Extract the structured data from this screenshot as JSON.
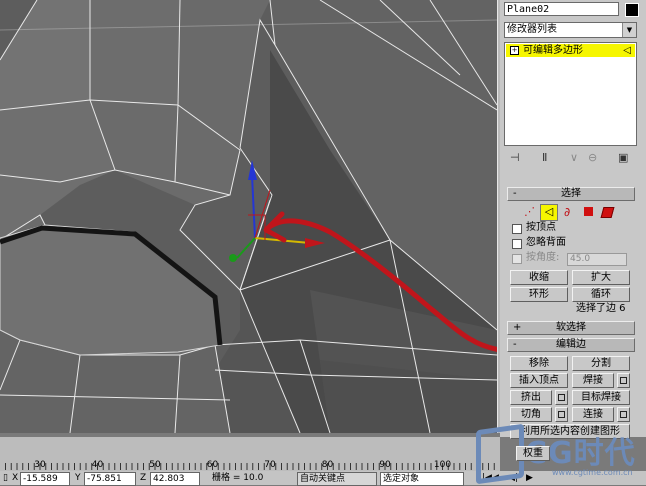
{
  "panel": {
    "object_name": "Plane02",
    "object_color": "#000000",
    "modifier_list": "修改器列表",
    "stack_item": "可编辑多边形",
    "stack_highlight": "#f6f600"
  },
  "rollouts": {
    "selection": {
      "header": "选择",
      "sign": "-",
      "by_vertex": "按顶点",
      "ignore_backfacing": "忽略背面",
      "by_angle": "按角度:",
      "angle_value": "45.0",
      "shrink": "收缩",
      "grow": "扩大",
      "ring": "环形",
      "loop": "循环",
      "status": "选择了边 6"
    },
    "soft_selection": {
      "header": "软选择",
      "sign": "+"
    },
    "edit_edges": {
      "header": "编辑边",
      "sign": "-",
      "remove": "移除",
      "split": "分割",
      "insert_vertex": "插入顶点",
      "weld": "焊接",
      "extrude": "挤出",
      "target_weld": "目标焊接",
      "chamfer": "切角",
      "connect": "连接",
      "create_shape": "利用所选内容创建图形",
      "weight": "权重"
    }
  },
  "timeline": {
    "ticks": [
      "30",
      "40",
      "50",
      "60",
      "70",
      "80",
      "90",
      "100"
    ]
  },
  "status": {
    "x_label": "X",
    "x_value": "-15.589",
    "y_label": "Y",
    "y_value": "-75.851",
    "z_label": "Z",
    "z_value": "42.803",
    "grid_label": "栅格 = 10.0",
    "auto_key": "自动关键点",
    "selected_object": "选定对象"
  },
  "watermark": {
    "title": "CG时代",
    "url": "www.cgtime.com.cn"
  },
  "colors": {
    "arrow": "#c0151b",
    "viewport_bg": "#5d5d5d",
    "highlighted_edge": "#141414"
  }
}
